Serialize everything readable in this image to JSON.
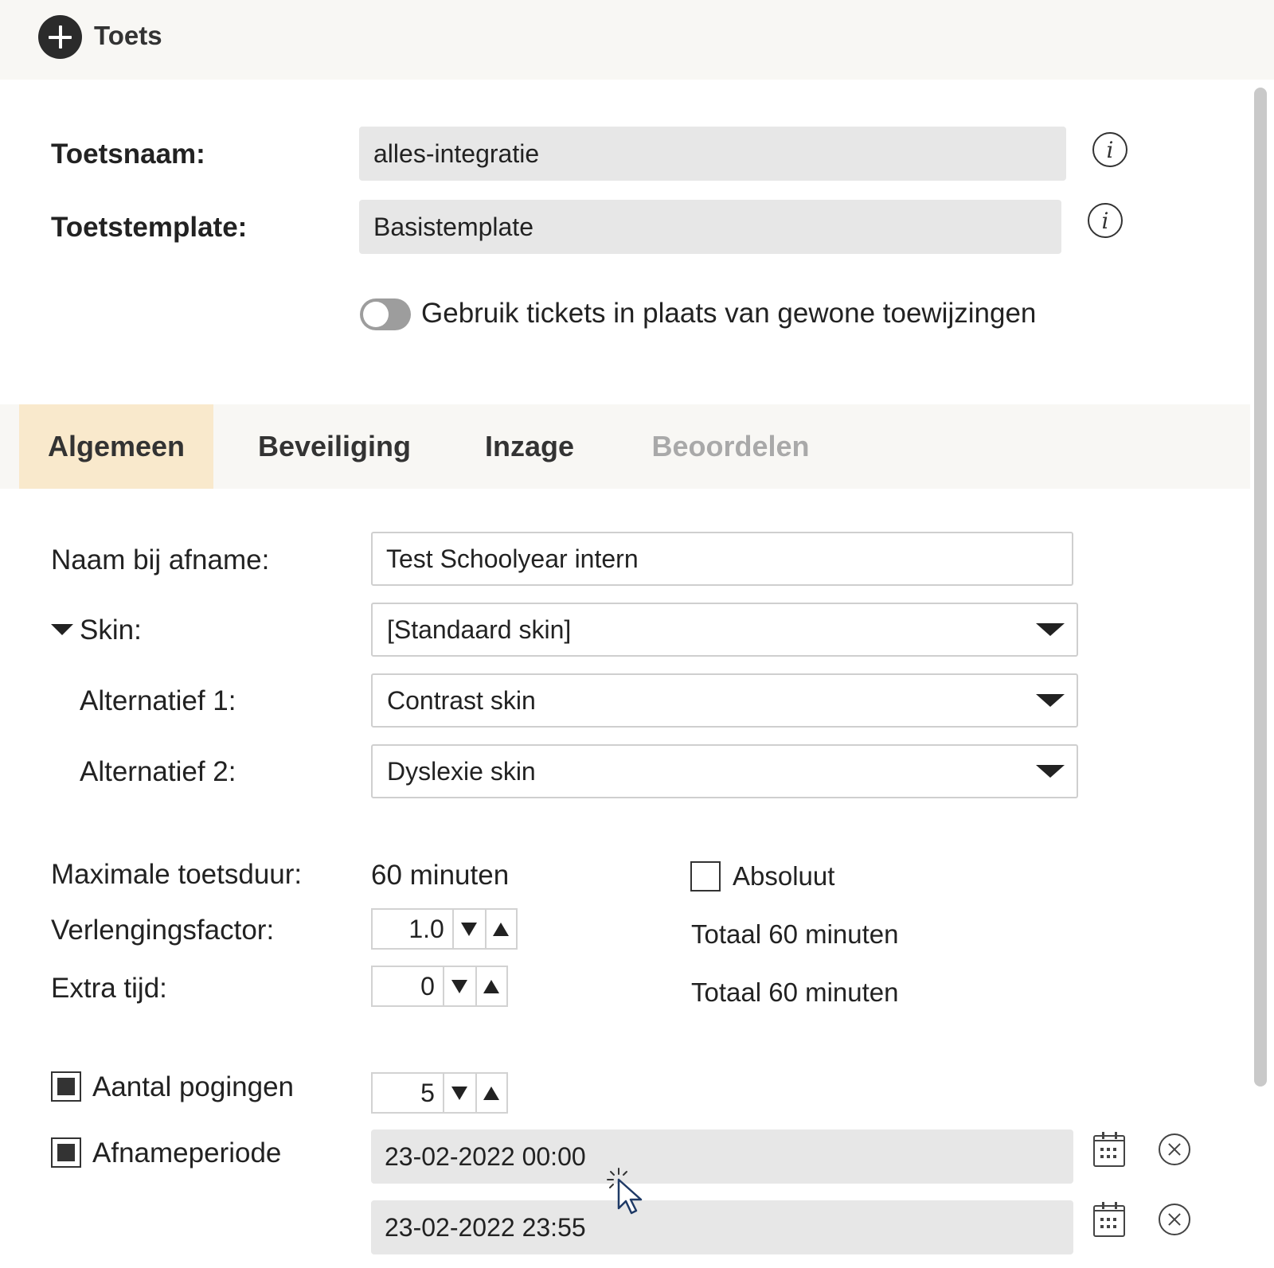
{
  "header": {
    "title": "Toets",
    "add_icon": "plus-circle-icon"
  },
  "form": {
    "toetsnaam_label": "Toetsnaam:",
    "toetsnaam_value": "alles-integratie",
    "toetstemplate_label": "Toetstemplate:",
    "toetstemplate_value": "Basistemplate",
    "info_icon": "info-icon",
    "tickets_toggle_label": "Gebruik tickets in plaats van gewone toewijzingen",
    "tickets_toggle_on": false
  },
  "tabs": [
    {
      "label": "Algemeen",
      "state": "active"
    },
    {
      "label": "Beveiliging",
      "state": "normal"
    },
    {
      "label": "Inzage",
      "state": "normal"
    },
    {
      "label": "Beoordelen",
      "state": "disabled"
    }
  ],
  "algemeen": {
    "naam_label": "Naam bij afname:",
    "naam_value": "Test Schoolyear intern",
    "skin_label": "Skin:",
    "skin_value": "[Standaard skin]",
    "alt1_label": "Alternatief 1:",
    "alt1_value": "Contrast skin",
    "alt2_label": "Alternatief 2:",
    "alt2_value": "Dyslexie skin",
    "max_duur_label": "Maximale toetsduur:",
    "max_duur_value": "60 minuten",
    "absoluut_label": "Absoluut",
    "absoluut_checked": false,
    "verlenging_label": "Verlengingsfactor:",
    "verlenging_value": "1.0",
    "verlenging_totaal": "Totaal 60 minuten",
    "extra_label": "Extra tijd:",
    "extra_value": "0",
    "extra_totaal": "Totaal 60 minuten",
    "pogingen_label": "Aantal pogingen",
    "pogingen_checked": true,
    "pogingen_value": "5",
    "periode_label": "Afnameperiode",
    "periode_checked": true,
    "periode_start": "23-02-2022 00:00",
    "periode_end": "23-02-2022 23:55"
  },
  "colors": {
    "header_bg": "#f8f7f4",
    "active_tab_bg": "#f9e9cc",
    "readonly_field_bg": "#e7e7e7",
    "disabled_text": "#a9a9a9"
  }
}
